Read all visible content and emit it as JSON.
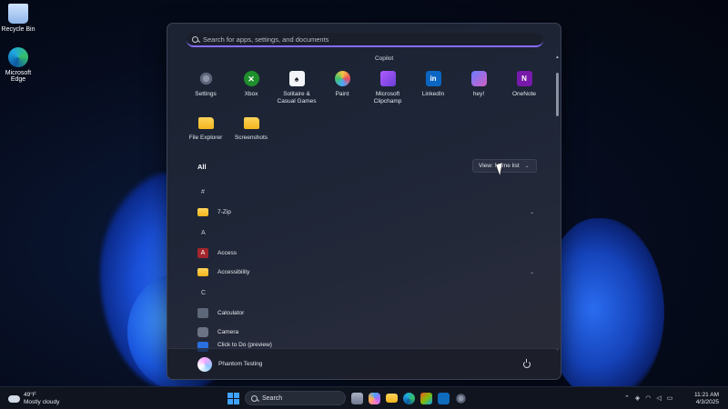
{
  "desktop": {
    "icons": [
      {
        "label": "Recycle Bin",
        "icon": "recycle-bin-icon"
      },
      {
        "label": "Microsoft Edge",
        "icon": "edge-icon"
      }
    ]
  },
  "start_menu": {
    "search": {
      "placeholder": "Search for apps, settings, and documents"
    },
    "top_label": "Copilot",
    "pinned": [
      {
        "label": "Settings",
        "icon": "settings-icon"
      },
      {
        "label": "Xbox",
        "icon": "xbox-icon"
      },
      {
        "label": "Solitaire & Casual Games",
        "icon": "solitaire-icon"
      },
      {
        "label": "Paint",
        "icon": "paint-icon"
      },
      {
        "label": "Microsoft Clipchamp",
        "icon": "clipchamp-icon"
      },
      {
        "label": "LinkedIn",
        "icon": "linkedin-icon"
      },
      {
        "label": "hey!",
        "icon": "hey-icon"
      },
      {
        "label": "OneNote",
        "icon": "onenote-icon"
      },
      {
        "label": "File Explorer",
        "icon": "folder-icon"
      },
      {
        "label": "Screenshots",
        "icon": "folder-icon"
      }
    ],
    "all_header": "All",
    "view_button": "View: Name list",
    "app_list": [
      {
        "type": "letter",
        "label": "#"
      },
      {
        "type": "app",
        "label": "7-Zip",
        "icon": "folder-icon",
        "expandable": true
      },
      {
        "type": "letter",
        "label": "A"
      },
      {
        "type": "app",
        "label": "Access",
        "icon": "access-icon",
        "expandable": false
      },
      {
        "type": "app",
        "label": "Accessibility",
        "icon": "folder-icon",
        "expandable": true
      },
      {
        "type": "letter",
        "label": "C"
      },
      {
        "type": "app",
        "label": "Calculator",
        "icon": "calculator-icon",
        "expandable": false
      },
      {
        "type": "app",
        "label": "Camera",
        "icon": "camera-icon",
        "expandable": false
      },
      {
        "type": "app",
        "label": "Click to Do (preview)",
        "icon": "click-to-do-icon",
        "expandable": false
      }
    ],
    "footer": {
      "user_name": "Phantom Testing"
    }
  },
  "taskbar": {
    "weather": {
      "temp": "49°F",
      "condition": "Mostly cloudy"
    },
    "search_label": "Search",
    "clock": {
      "time": "11:21 AM",
      "date": "4/3/2025"
    },
    "tray_icons": [
      "chevron-up-icon",
      "network-icon",
      "wifi-icon",
      "volume-icon",
      "battery-icon"
    ]
  }
}
